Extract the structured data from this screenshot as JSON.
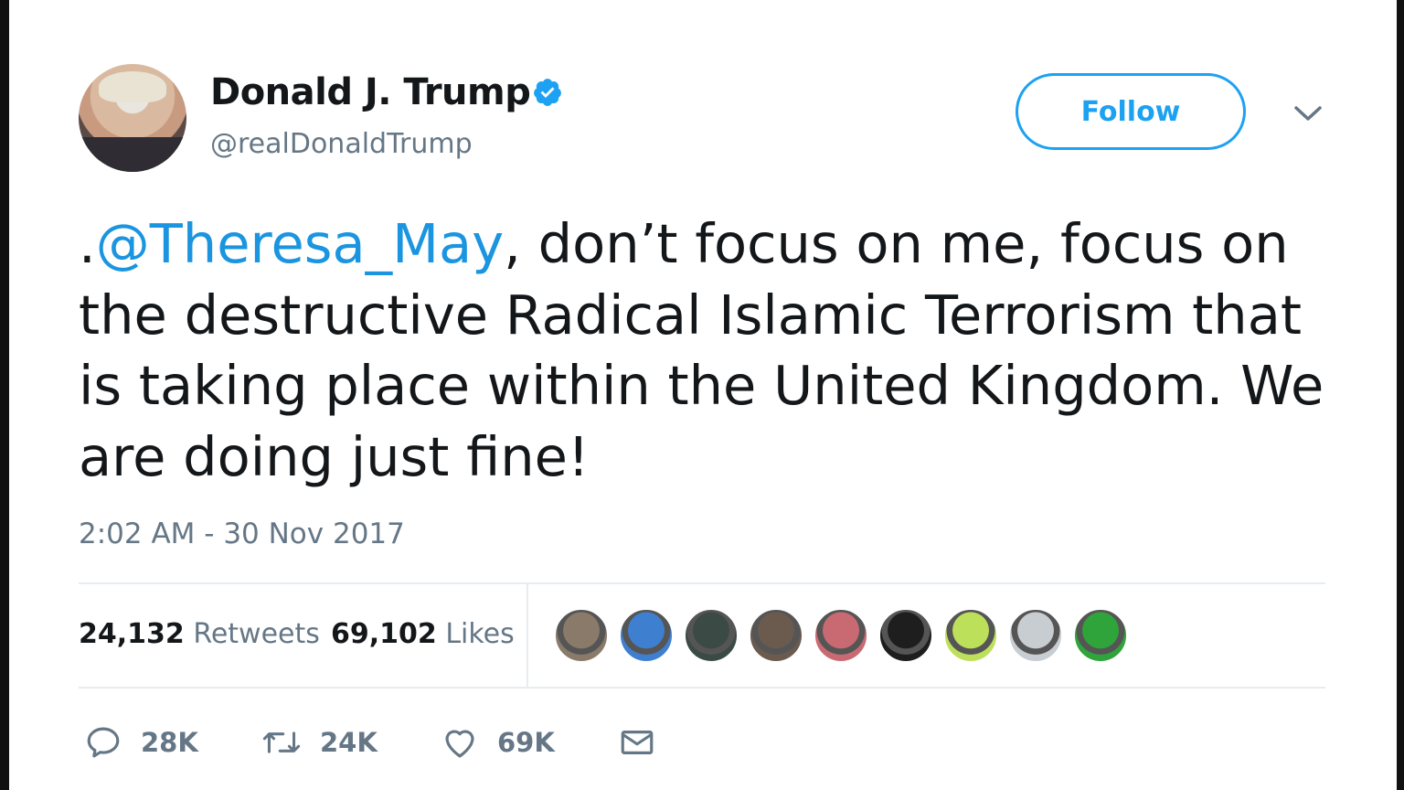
{
  "profile": {
    "name": "Donald J. Trump",
    "handle": "@realDonaldTrump",
    "verified": true
  },
  "follow_button": {
    "label": "Follow"
  },
  "tweet": {
    "prefix": ".",
    "mention": "@Theresa_May",
    "body": ", don’t focus on me, focus on the destructive Radical Islamic Terrorism that is taking place within the United Kingdom. We are doing just fine!",
    "timestamp": "2:02 AM - 30 Nov 2017"
  },
  "stats": {
    "retweets_count": "24,132",
    "retweets_label": "Retweets",
    "likes_count": "69,102",
    "likes_label": "Likes"
  },
  "likers": [
    {
      "name": "liker-1",
      "color": "#8a7a6a"
    },
    {
      "name": "liker-2",
      "color": "#3f7fd0"
    },
    {
      "name": "liker-3",
      "color": "#3b4a45"
    },
    {
      "name": "liker-4",
      "color": "#6b5a4e"
    },
    {
      "name": "liker-5",
      "color": "#c96a72"
    },
    {
      "name": "liker-6",
      "color": "#1e1e1e"
    },
    {
      "name": "liker-7",
      "color": "#bde05a"
    },
    {
      "name": "liker-8",
      "color": "#c8cdd2"
    },
    {
      "name": "liker-9",
      "color": "#2ea43a"
    }
  ],
  "actions": {
    "reply_count": "28K",
    "retweet_count": "24K",
    "like_count": "69K"
  },
  "colors": {
    "accent": "#1da1f2",
    "mention": "#1b95e0",
    "secondary_text": "#657786",
    "divider": "#e6ecf0"
  }
}
